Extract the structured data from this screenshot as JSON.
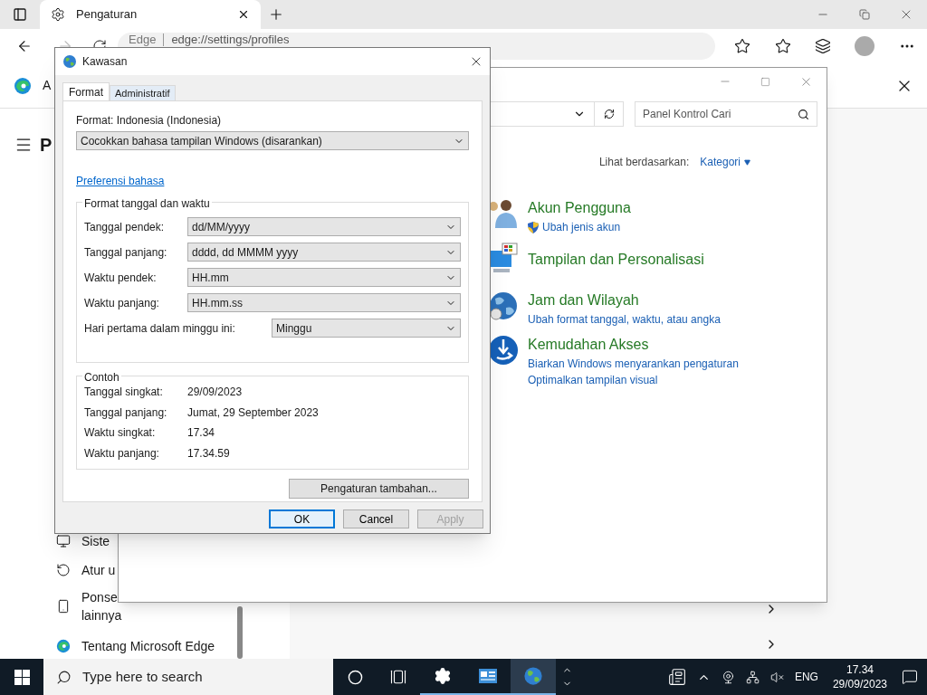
{
  "browser": {
    "tab": {
      "title": "Pengaturan"
    },
    "address": {
      "site": "Edge",
      "url": "edge://settings/profiles"
    },
    "header_text": "A",
    "page_title": "P",
    "sidebar_items": [
      {
        "kind": "system",
        "label": "Siste"
      },
      {
        "kind": "reset",
        "label": "Atur u"
      },
      {
        "kind": "phone",
        "label": "Ponse",
        "line2": "lainnya"
      },
      {
        "kind": "edge",
        "label": "Tentang Microsoft Edge"
      }
    ]
  },
  "control_panel": {
    "search": {
      "placeholder": "Panel Kontrol Cari"
    },
    "view_by": {
      "label": "Lihat berdasarkan:",
      "value": "Kategori"
    },
    "categories": [
      {
        "kind": "users",
        "title": "Akun Pengguna",
        "links": [
          {
            "text": "Ubah jenis akun",
            "shield": true
          }
        ]
      },
      {
        "kind": "display",
        "title": "Tampilan dan Personalisasi"
      },
      {
        "kind": "clock",
        "title": "Jam dan Wilayah",
        "links": [
          {
            "text": "Ubah format tanggal, waktu, atau angka",
            "shield": false
          }
        ]
      },
      {
        "kind": "access",
        "title": "Kemudahan Akses",
        "links": [
          {
            "text": "Biarkan Windows menyarankan pengaturan",
            "shield": false
          },
          {
            "text": "Optimalkan tampilan visual",
            "shield": false
          }
        ]
      }
    ]
  },
  "dialog": {
    "title": "Kawasan",
    "tabs": [
      {
        "label": "Format",
        "selected": true
      },
      {
        "label": "Administratif",
        "selected": false
      }
    ],
    "format_label": "Format: Indonesia (Indonesia)",
    "format_value": "Cocokkan bahasa tampilan Windows (disarankan)",
    "language_link": "Preferensi bahasa",
    "datetime_group": {
      "title": "Format tanggal dan waktu",
      "fields": [
        {
          "kind": "format",
          "label": "Tanggal pendek:",
          "value": "dd/MM/yyyy"
        },
        {
          "kind": "format",
          "label": "Tanggal panjang:",
          "value": "dddd, dd MMMM yyyy"
        },
        {
          "kind": "format",
          "label": "Waktu pendek:",
          "value": "HH.mm"
        },
        {
          "kind": "format",
          "label": "Waktu panjang:",
          "value": "HH.mm.ss"
        },
        {
          "kind": "first_day",
          "label": "Hari pertama dalam minggu ini:",
          "value": "Minggu"
        }
      ]
    },
    "sample_group": {
      "title": "Contoh",
      "rows": [
        {
          "label": "Tanggal singkat:",
          "value": "29/09/2023"
        },
        {
          "label": "Tanggal panjang:",
          "value": "Jumat, 29 September 2023"
        },
        {
          "label": "Waktu singkat:",
          "value": "17.34"
        },
        {
          "label": "Waktu panjang:",
          "value": "17.34.59"
        }
      ]
    },
    "additional_button": "Pengaturan tambahan...",
    "buttons": [
      {
        "label": "OK",
        "default": true,
        "disabled": false
      },
      {
        "label": "Cancel",
        "default": false,
        "disabled": false
      },
      {
        "label": "Apply",
        "default": false,
        "disabled": true
      }
    ]
  },
  "taskbar": {
    "search": {
      "placeholder": "Type here to search"
    },
    "apps": [
      {
        "kind": "settings",
        "running": true,
        "active": false
      },
      {
        "kind": "control_panel",
        "running": true,
        "active": false
      },
      {
        "kind": "region",
        "running": true,
        "active": true
      }
    ],
    "language": "ENG",
    "time": "17.34",
    "date": "29/09/2023"
  }
}
